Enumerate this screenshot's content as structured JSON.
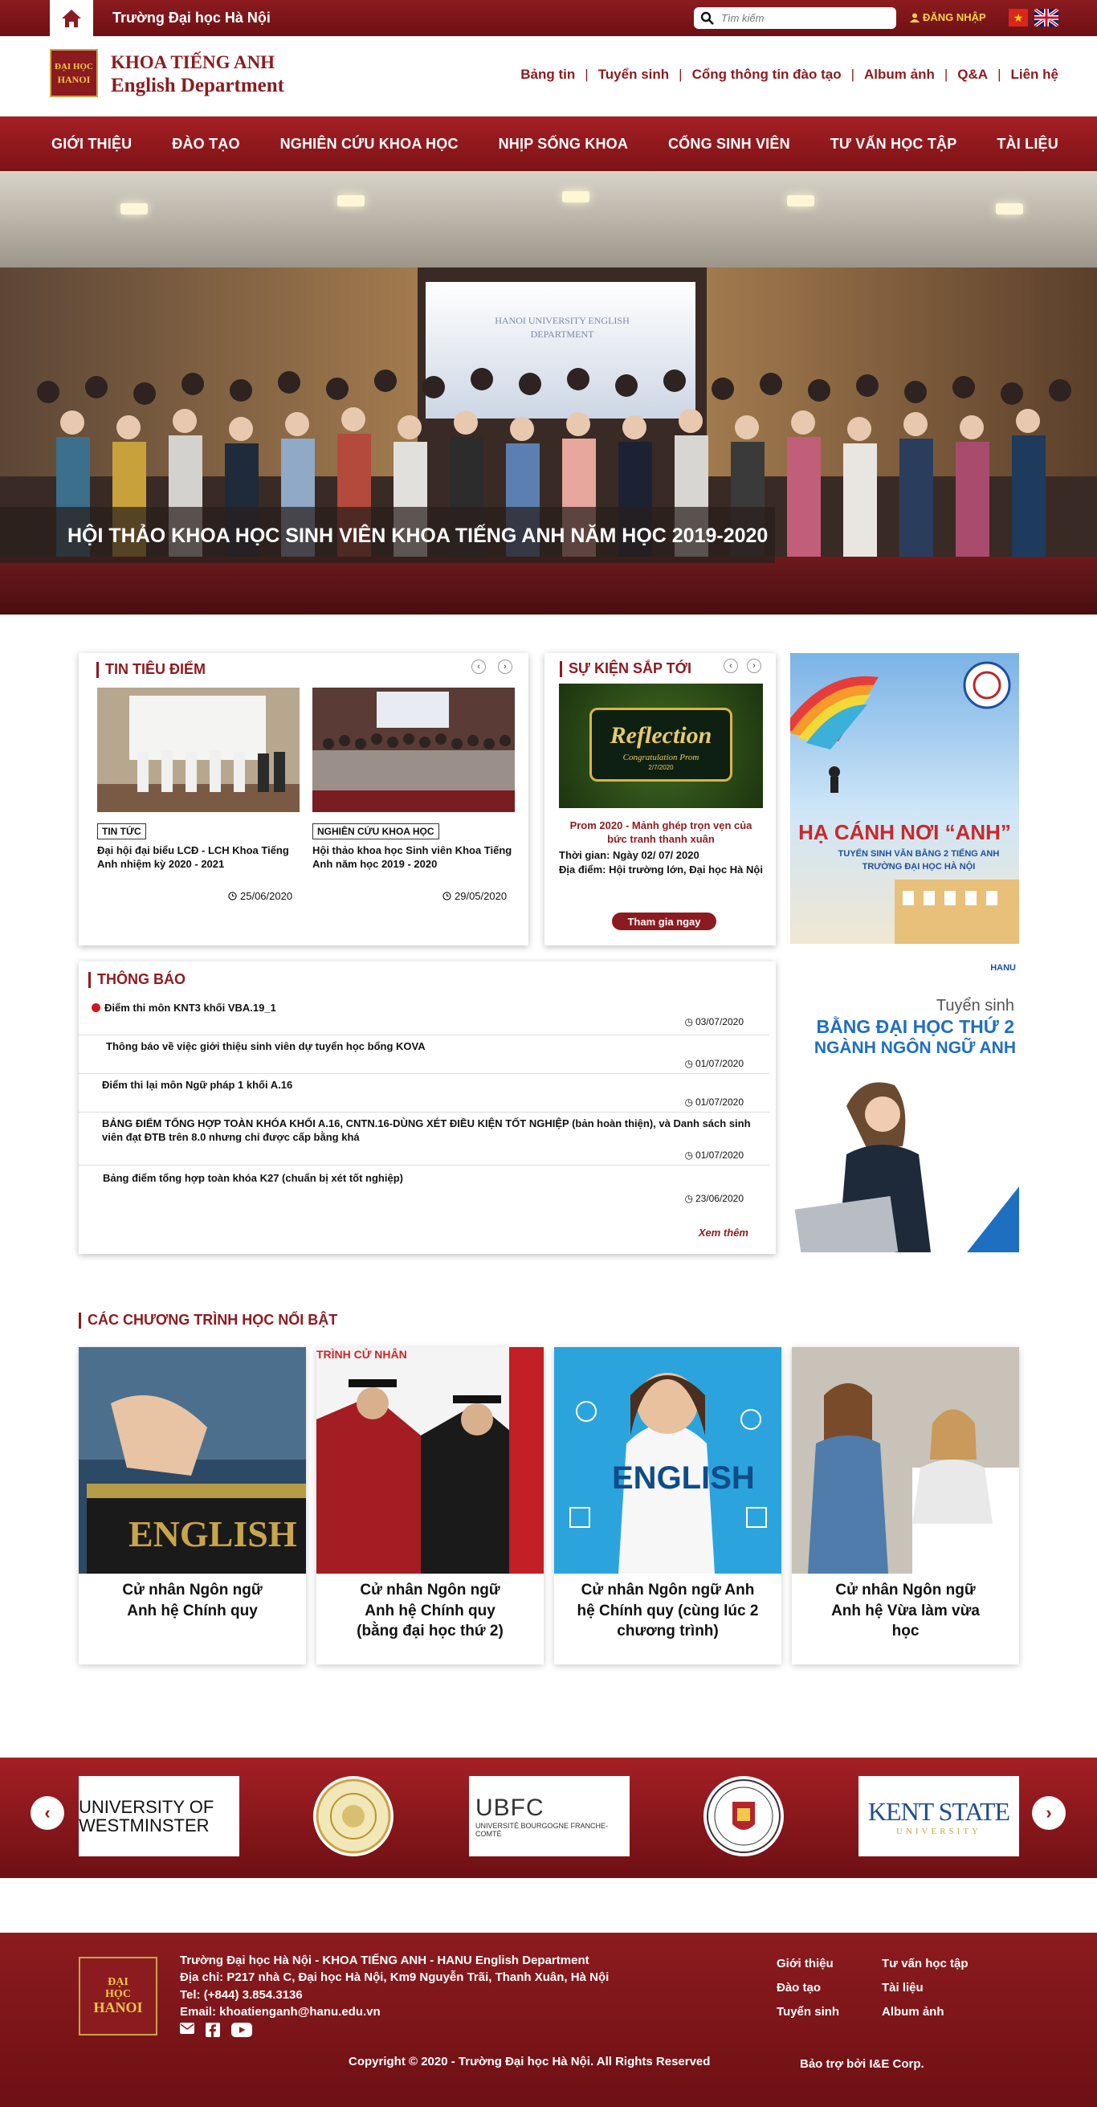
{
  "topbar": {
    "title": "Trường Đại học Hà Nội",
    "search_placeholder": "Tìm kiếm",
    "login_label": "ĐĂNG NHẬP"
  },
  "header": {
    "logo_lines": [
      "ĐẠI HỌC",
      "HANOI"
    ],
    "brand_vi": "KHOA TIẾNG ANH",
    "brand_en": "English Department",
    "quick_links": [
      "Bảng tin",
      "Tuyển sinh",
      "Cổng thông tin đào tạo",
      "Album ảnh",
      "Q&A",
      "Liên hệ"
    ]
  },
  "nav": {
    "items": [
      "GIỚI THIỆU",
      "ĐÀO TẠO",
      "NGHIÊN CỨU KHOA HỌC",
      "NHỊP SỐNG KHOA",
      "CỔNG SINH VIÊN",
      "TƯ VẤN HỌC TẬP",
      "TÀI LIỆU"
    ]
  },
  "hero": {
    "caption": "HỘI THẢO KHOA HỌC SINH VIÊN KHOA TIẾNG ANH NĂM HỌC 2019-2020",
    "screen_text": "HANOI UNIVERSITY ENGLISH DEPARTMENT"
  },
  "featured": {
    "title": "TIN TIÊU ĐIỂM",
    "items": [
      {
        "tag": "TIN TỨC",
        "title": "Đại hội đại biểu LCĐ - LCH Khoa Tiếng Anh nhiệm kỳ 2020 - 2021",
        "date": "25/06/2020"
      },
      {
        "tag": "NGHIÊN CỨU KHOA HỌC",
        "title": "Hội thảo khoa học Sinh viên Khoa Tiếng Anh năm học 2019 - 2020",
        "date": "29/05/2020"
      }
    ]
  },
  "events": {
    "title": "SỰ KIỆN SẮP TỚI",
    "poster_title": "Reflection",
    "poster_sub": "Congratulation Prom",
    "poster_date": "2/7/2020",
    "event_title": "Prom 2020 - Mảnh ghép trọn vẹn của bức tranh thanh xuân",
    "time": "Thời gian: Ngày 02/ 07/ 2020",
    "place": "Địa điểm: Hội trường lớn, Đại học Hà Nội",
    "button": "Tham gia ngay"
  },
  "banner1": {
    "headline": "HẠ CÁNH NƠI “ANH”",
    "sub1": "TUYỂN SINH VĂN BẰNG 2 TIẾNG ANH",
    "sub2": "TRƯỜNG ĐẠI HỌC HÀ NỘI"
  },
  "notices": {
    "title": "THÔNG BÁO",
    "items": [
      {
        "text": "Điểm thi môn KNT3 khối VBA.19_1",
        "date": "03/07/2020"
      },
      {
        "text": "Thông báo về việc giới thiệu sinh viên dự tuyển học bổng KOVA",
        "date": "01/07/2020"
      },
      {
        "text": "Điểm thi lại môn Ngữ pháp 1 khối A.16",
        "date": "01/07/2020"
      },
      {
        "text": "BẢNG ĐIỂM TỔNG HỢP TOÀN KHÓA KHỐI A.16, CNTN.16-DÙNG XÉT ĐIỀU KIỆN TỐT NGHIỆP (bản hoàn thiện), và Danh sách sinh viên đạt ĐTB trên 8.0 nhưng chỉ được cấp bằng khá",
        "date": "01/07/2020"
      },
      {
        "text": "Bảng điểm tổng hợp toàn khóa K27 (chuẩn bị xét tốt nghiệp)",
        "date": "23/06/2020"
      }
    ],
    "more": "Xem thêm"
  },
  "banner2": {
    "badge": "HANU",
    "line1": "Tuyển sinh",
    "line2": "BẰNG ĐẠI HỌC THỨ 2",
    "line3": "NGÀNH NGÔN NGỮ ANH"
  },
  "programs": {
    "title": "CÁC CHƯƠNG TRÌNH HỌC NỔI BẬT",
    "items": [
      {
        "label": "Cử nhân Ngôn ngữ Anh hệ Chính quy",
        "img_text": "ENGLISH"
      },
      {
        "label": "Cử nhân Ngôn ngữ Anh hệ Chính quy (bằng đại học thứ 2)",
        "img_text": "TRÌNH CỬ NHÂN"
      },
      {
        "label": "Cử nhân Ngôn ngữ Anh hệ Chính quy (cùng lúc 2 chương trình)",
        "img_text": "ENGLISH"
      },
      {
        "label": "Cử nhân Ngôn ngữ Anh hệ Vừa làm vừa học",
        "img_text": ""
      }
    ]
  },
  "partners": {
    "items": [
      "UNIVERSITY OF WESTMINSTER",
      "UBFC",
      "UNIVERSITÉ BOURGOGNE FRANCHE-COMTÉ",
      "KENT STATE",
      "UNIVERSITY"
    ]
  },
  "footer": {
    "logo_lines": [
      "ĐẠI",
      "HỌC",
      "HANOI"
    ],
    "line1": "Trường Đại học Hà Nội - KHOA TIẾNG ANH - HANU English Department",
    "line2": "Địa chỉ:  P217 nhà C, Đại học Hà Nội, Km9 Nguyễn Trãi, Thanh Xuân, Hà Nội",
    "line3": "Tel: (+844) 3.854.3136",
    "line4": "Email: khoatienganh@hanu.edu.vn",
    "links_col1": [
      "Giới thiệu",
      "Đào tạo",
      "Tuyển sinh"
    ],
    "links_col2": [
      "Tư vấn học tập",
      "Tài liệu",
      "Album ảnh"
    ],
    "copyright": "Copyright © 2020 - Trường Đại học Hà Nội. All Rights Reserved",
    "sponsor": "Bảo trợ bởi I&E Corp."
  }
}
